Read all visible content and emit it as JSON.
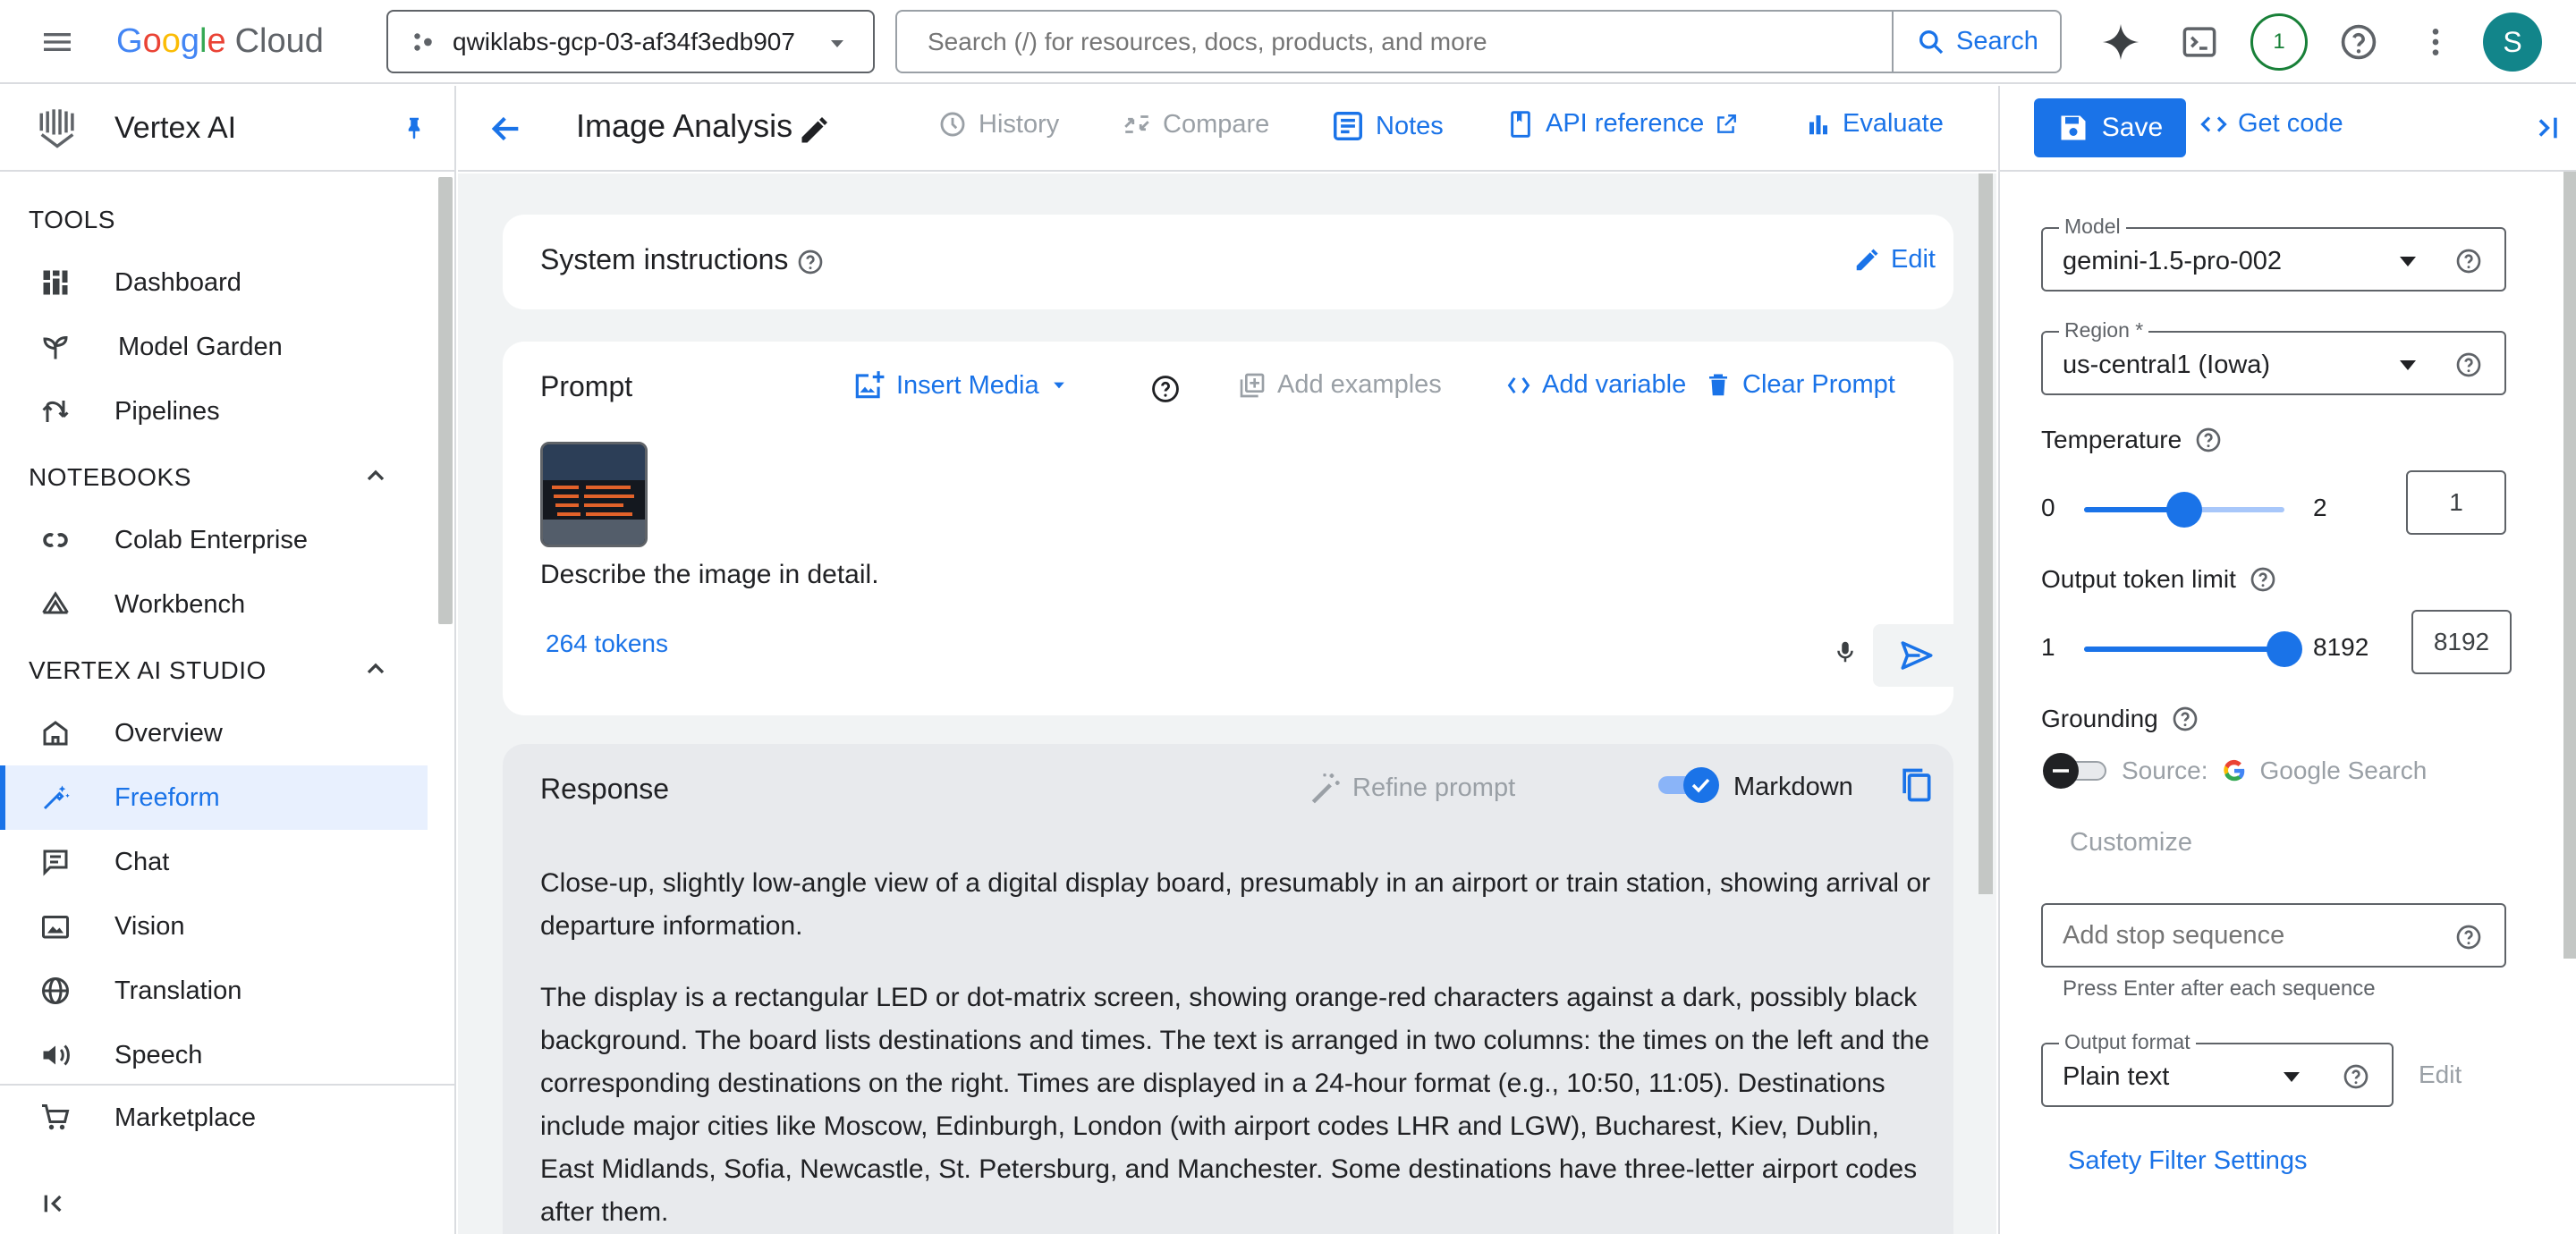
{
  "topbar": {
    "logo_letters": [
      "G",
      "o",
      "o",
      "g",
      "l",
      "e"
    ],
    "logo_suffix": "Cloud",
    "project": "qwiklabs-gcp-03-af34f3edb907",
    "search_placeholder": "Search (/) for resources, docs, products, and more",
    "search_button": "Search",
    "notification_count": "1",
    "avatar_initial": "S"
  },
  "leftnav": {
    "product": "Vertex AI",
    "sections": {
      "tools": "TOOLS",
      "notebooks": "NOTEBOOKS",
      "studio": "VERTEX AI STUDIO"
    },
    "tools_items": [
      "Dashboard",
      "Model Garden",
      "Pipelines"
    ],
    "notebooks_items": [
      "Colab Enterprise",
      "Workbench"
    ],
    "studio_items": [
      "Overview",
      "Freeform",
      "Chat",
      "Vision",
      "Translation",
      "Speech"
    ],
    "marketplace": "Marketplace",
    "active_item": "Freeform"
  },
  "header": {
    "title": "Image Analysis",
    "history": "History",
    "compare": "Compare",
    "notes": "Notes",
    "api_reference": "API reference",
    "evaluate": "Evaluate"
  },
  "system_instructions": {
    "title": "System instructions",
    "edit": "Edit"
  },
  "prompt": {
    "title": "Prompt",
    "insert_media": "Insert Media",
    "add_examples": "Add examples",
    "add_variable": "Add variable",
    "clear_prompt": "Clear Prompt",
    "text": "Describe the image in detail.",
    "tokens": "264 tokens"
  },
  "response": {
    "title": "Response",
    "refine_prompt": "Refine prompt",
    "markdown_label": "Markdown",
    "markdown_enabled": true,
    "paragraphs": [
      "Close-up, slightly low-angle view of a digital display board, presumably in an airport or train station, showing arrival or departure information.",
      "The display is a rectangular LED or dot-matrix screen, showing orange-red characters against a dark, possibly black background.  The board lists destinations and times. The text is arranged in two columns: the times on the left and the corresponding destinations on the right.  Times are displayed in a 24-hour format (e.g., 10:50, 11:05). Destinations include major cities like Moscow, Edinburgh, London (with airport codes LHR and LGW), Bucharest, Kiev, Dublin, East Midlands, Sofia, Newcastle, St. Petersburg, and Manchester.  Some destinations have three-letter airport codes after them."
    ]
  },
  "right_panel": {
    "save": "Save",
    "get_code": "Get code",
    "model_label": "Model",
    "model_value": "gemini-1.5-pro-002",
    "region_label": "Region *",
    "region_value": "us-central1 (Iowa)",
    "temperature_label": "Temperature",
    "temperature_min": "0",
    "temperature_max": "2",
    "temperature_value": "1",
    "temperature_fraction": 0.5,
    "token_label": "Output token limit",
    "token_min": "1",
    "token_max": "8192",
    "token_value": "8192",
    "token_fraction": 1.0,
    "grounding_label": "Grounding",
    "grounding_source_label": "Source:",
    "grounding_source": "Google Search",
    "customize": "Customize",
    "stop_placeholder": "Add stop sequence",
    "stop_hint": "Press Enter after each sequence",
    "output_format_label": "Output format",
    "output_format_value": "Plain text",
    "output_format_edit": "Edit",
    "safety": "Safety Filter Settings"
  },
  "colors": {
    "accent": "#1a73e8",
    "active_bg": "#e8f0fe",
    "response_bg": "#e8eaed",
    "notif_green": "#188038",
    "avatar_bg": "#12858a"
  }
}
